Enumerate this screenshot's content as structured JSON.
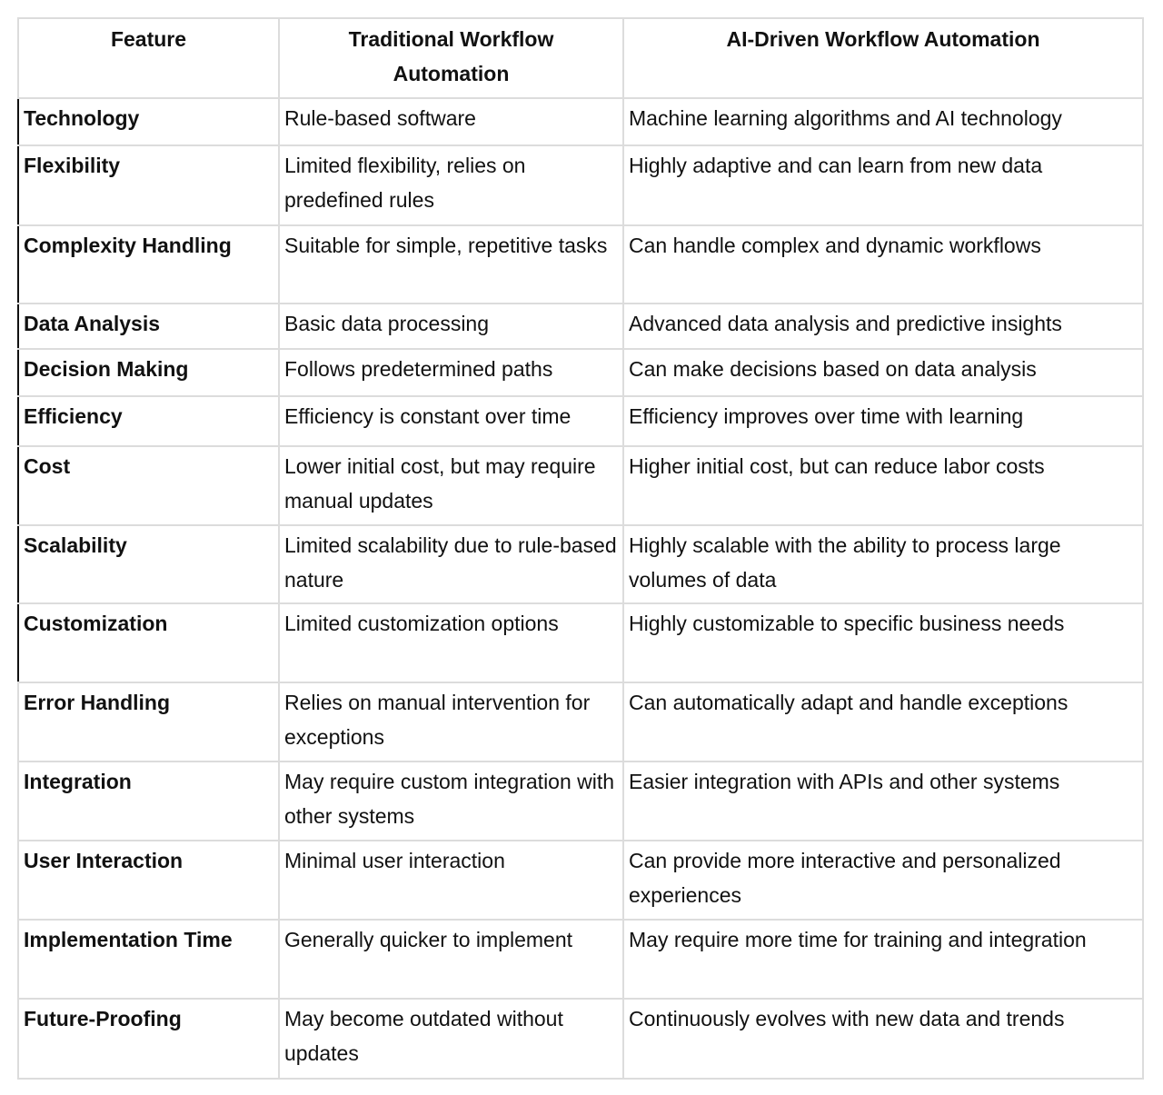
{
  "headers": [
    "Feature",
    "Traditional Workflow Automation",
    "AI-Driven Workflow Automation"
  ],
  "rows": [
    {
      "feature": "Technology",
      "traditional": "Rule-based software",
      "ai": "Machine learning algorithms and AI technology"
    },
    {
      "feature": "Flexibility",
      "traditional": "Limited flexibility, relies on predefined rules",
      "ai": "Highly adaptive and can learn from new data"
    },
    {
      "feature": "Complexity Handling",
      "traditional": "Suitable for simple, repetitive tasks",
      "ai": "Can handle complex and dynamic workflows"
    },
    {
      "feature": "Data Analysis",
      "traditional": "Basic data processing",
      "ai": "Advanced data analysis and predictive insights"
    },
    {
      "feature": "Decision Making",
      "traditional": "Follows predetermined paths",
      "ai": "Can make decisions based on data analysis"
    },
    {
      "feature": "Efficiency",
      "traditional": "Efficiency is constant over time",
      "ai": "Efficiency improves over time with learning"
    },
    {
      "feature": "Cost",
      "traditional": "Lower initial cost, but may require manual updates",
      "ai": "Higher initial cost, but can reduce labor costs"
    },
    {
      "feature": "Scalability",
      "traditional": "Limited scalability due to rule-based nature",
      "ai": "Highly scalable with the ability to process large volumes of data"
    },
    {
      "feature": "Customization",
      "traditional": "Limited customization options",
      "ai": "Highly customizable to specific business needs"
    },
    {
      "feature": "Error Handling",
      "traditional": "Relies on manual intervention for exceptions",
      "ai": "Can automatically adapt and handle exceptions"
    },
    {
      "feature": "Integration",
      "traditional": "May require custom integration with other systems",
      "ai": "Easier integration with APIs and other systems"
    },
    {
      "feature": "User Interaction",
      "traditional": "Minimal user interaction",
      "ai": "Can provide more interactive and personalized experiences"
    },
    {
      "feature": "Implementation Time",
      "traditional": "Generally quicker to implement",
      "ai": "May require more time for training and integration"
    },
    {
      "feature": "Future-Proofing",
      "traditional": "May become outdated without updates",
      "ai": "Continuously evolves with new data and trends"
    }
  ]
}
